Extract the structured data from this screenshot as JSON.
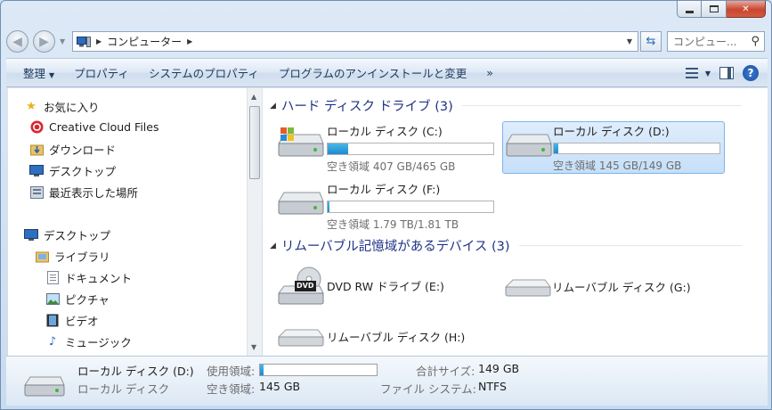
{
  "window": {
    "caption_buttons": [
      "minimize",
      "maximize",
      "close"
    ]
  },
  "address_bar": {
    "crumbs": [
      "コンピューター"
    ],
    "search_placeholder": "コンピュー..."
  },
  "command_bar": {
    "items": [
      "整理",
      "プロパティ",
      "システムのプロパティ",
      "プログラムのアンインストールと変更",
      "»"
    ]
  },
  "nav_pane": {
    "favorites": [
      {
        "label": "お気に入り",
        "icon": "star-icon"
      },
      {
        "label": "Creative Cloud Files",
        "icon": "creative-cloud-icon"
      },
      {
        "label": "ダウンロード",
        "icon": "downloads-folder-icon"
      },
      {
        "label": "デスクトップ",
        "icon": "desktop-icon"
      },
      {
        "label": "最近表示した場所",
        "icon": "recent-places-icon"
      }
    ],
    "desktop": {
      "label": "デスクトップ",
      "icon": "desktop-icon"
    },
    "libraries": {
      "label": "ライブラリ",
      "icon": "library-icon"
    },
    "library_items": [
      {
        "label": "ドキュメント",
        "icon": "documents-icon"
      },
      {
        "label": "ピクチャ",
        "icon": "pictures-icon"
      },
      {
        "label": "ビデオ",
        "icon": "videos-icon"
      },
      {
        "label": "ミュージック",
        "icon": "music-icon"
      }
    ]
  },
  "content": {
    "hdd_group": "ハード ディスク ドライブ (3)",
    "drives": [
      {
        "name": "ローカル ディスク (C:)",
        "free": "空き領域 407 GB/465 GB",
        "used_fraction": 0.125,
        "selected": false
      },
      {
        "name": "ローカル ディスク (D:)",
        "free": "空き領域 145 GB/149 GB",
        "used_fraction": 0.027,
        "selected": true
      },
      {
        "name": "ローカル ディスク (F:)",
        "free": "空き領域 1.79 TB/1.81 TB",
        "used_fraction": 0.011,
        "selected": false
      }
    ],
    "removable_group": "リムーバブル記憶域があるデバイス (3)",
    "removable": [
      {
        "name": "DVD RW ドライブ (E:)",
        "icon": "dvd-drive-icon"
      },
      {
        "name": "リムーバブル ディスク (G:)",
        "icon": "removable-disk-icon"
      },
      {
        "name": "リムーバブル ディスク (H:)",
        "icon": "removable-disk-icon"
      }
    ],
    "dvd_label": "DVD"
  },
  "details": {
    "name": "ローカル ディスク (D:)",
    "type": "ローカル ディスク",
    "used_label": "使用領域:",
    "free_label": "空き領域:",
    "free_value": "145 GB",
    "total_label": "合計サイズ:",
    "total_value": "149 GB",
    "fs_label": "ファイル システム:",
    "fs_value": "NTFS",
    "used_fraction": 0.027
  }
}
